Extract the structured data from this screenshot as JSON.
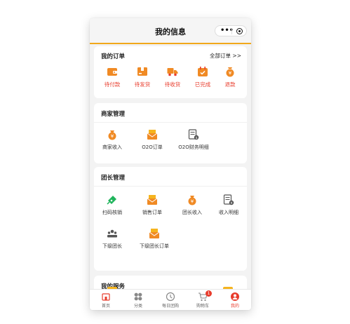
{
  "header": {
    "title": "我的信息",
    "menu_glyph": "•••"
  },
  "orders": {
    "title": "我的订单",
    "all_link": "全部订单 >>",
    "items": [
      {
        "label": "待付款",
        "icon": "wallet-icon"
      },
      {
        "label": "待发货",
        "icon": "package-icon"
      },
      {
        "label": "待收货",
        "icon": "truck-icon"
      },
      {
        "label": "已完成",
        "icon": "calendar-check-icon"
      },
      {
        "label": "退款",
        "icon": "refund-icon"
      }
    ]
  },
  "merchant": {
    "title": "商家管理",
    "items": [
      {
        "label": "商家收入",
        "icon": "money-bag-icon"
      },
      {
        "label": "O2O订单",
        "icon": "order-envelope-icon"
      },
      {
        "label": "O2O财务明细",
        "icon": "finance-detail-icon"
      }
    ]
  },
  "leader": {
    "title": "团长管理",
    "items": [
      {
        "label": "扫码核销",
        "icon": "ticket-icon"
      },
      {
        "label": "销售订单",
        "icon": "order-envelope-icon"
      },
      {
        "label": "团长收入",
        "icon": "money-bag-icon"
      },
      {
        "label": "收入明细",
        "icon": "income-detail-icon"
      },
      {
        "label": "下级团长",
        "icon": "team-icon"
      },
      {
        "label": "下级团长订单",
        "icon": "order-envelope-icon"
      }
    ]
  },
  "services": {
    "title": "我的服务"
  },
  "tabbar": {
    "items": [
      {
        "label": "首页",
        "icon": "home-icon"
      },
      {
        "label": "分类",
        "icon": "category-icon"
      },
      {
        "label": "每日团购",
        "icon": "clock-icon"
      },
      {
        "label": "购物车",
        "icon": "cart-icon",
        "badge": "1"
      },
      {
        "label": "我的",
        "icon": "profile-icon"
      }
    ],
    "active": "我的"
  },
  "colors": {
    "accent": "#f1a81b",
    "orange": "#f08a24",
    "red": "#e83c2c",
    "green": "#1fb45b"
  }
}
